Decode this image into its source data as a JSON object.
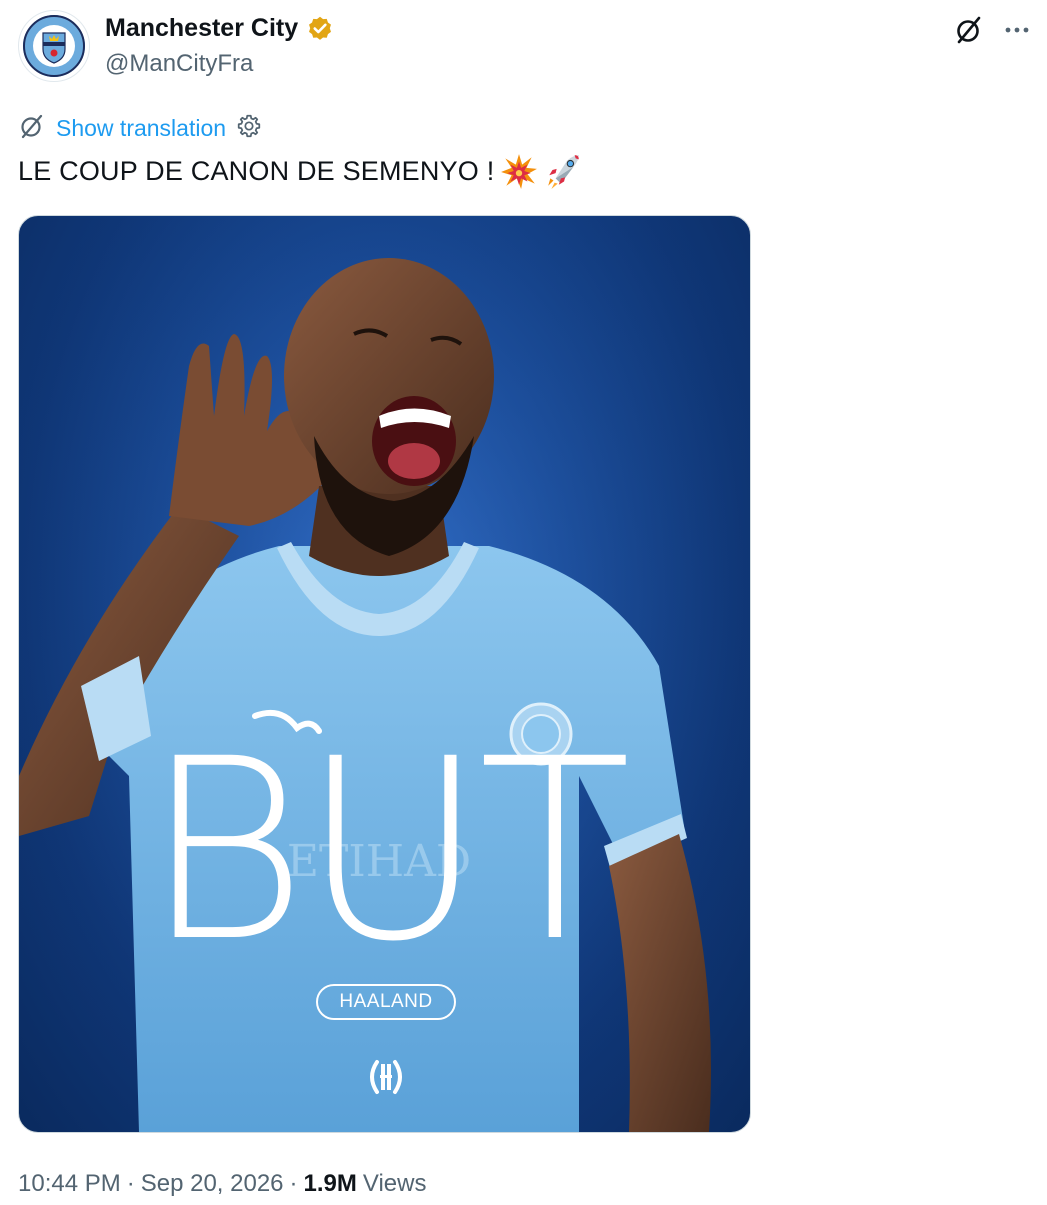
{
  "author": {
    "display_name": "Manchester City",
    "handle": "@ManCityFra",
    "verified": true,
    "verified_color": "#e2a514"
  },
  "translation": {
    "link_label": "Show translation",
    "link_color": "#1d9bf0"
  },
  "tweet": {
    "text": "LE COUP DE CANON DE SEMENYO !",
    "emojis": [
      "collision-emoji",
      "rocket-emoji"
    ]
  },
  "media": {
    "headline": "BUT",
    "scorer_pill": "HAALAND",
    "background_color": "#1a4d9c",
    "shirt_color": "#79b7e7"
  },
  "footer": {
    "time": "10:44 PM",
    "separator": "·",
    "date": "Sep 20, 2026",
    "views_count": "1.9M",
    "views_label": "Views"
  },
  "icons": {
    "grok": "grok-icon",
    "more": "more-icon",
    "translate": "translate-icon",
    "settings": "gear-icon"
  }
}
